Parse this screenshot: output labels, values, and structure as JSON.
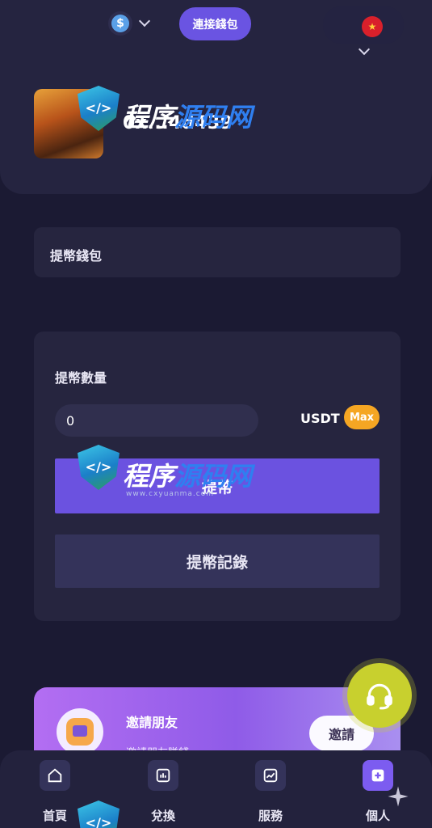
{
  "topbar": {
    "coin_icon": "usd-coin-icon",
    "coin_symbol": "$",
    "connect_label": "連接錢包",
    "language_flag": "china-flag-icon",
    "flag_glyph": "★"
  },
  "profile": {
    "account_id": "0x...4d439"
  },
  "watermark": {
    "shield_glyph": "</>",
    "text_a": "程序",
    "text_b": "源码网",
    "url": "www.cxyuanma.com"
  },
  "wallet": {
    "label": "提幣錢包"
  },
  "withdraw": {
    "amount_label": "提幣數量",
    "amount_value": "0",
    "unit": "USDT",
    "max_label": "Max",
    "submit_label": "提幣",
    "records_label": "提幣記錄"
  },
  "invite": {
    "title": "邀請朋友",
    "subtitle": "邀請朋友賺錢",
    "button_label": "邀請"
  },
  "support": {
    "icon": "headset-icon"
  },
  "nav": {
    "items": [
      {
        "label": "首頁",
        "icon": "home-icon"
      },
      {
        "label": "兌換",
        "icon": "exchange-icon"
      },
      {
        "label": "服務",
        "icon": "chart-icon"
      },
      {
        "label": "個人",
        "icon": "plus-icon"
      }
    ],
    "active_index": 3
  },
  "colors": {
    "background": "#1b1a33",
    "accent": "#6b52e0",
    "max_button": "#f5a623",
    "support": "#c8d02e"
  }
}
